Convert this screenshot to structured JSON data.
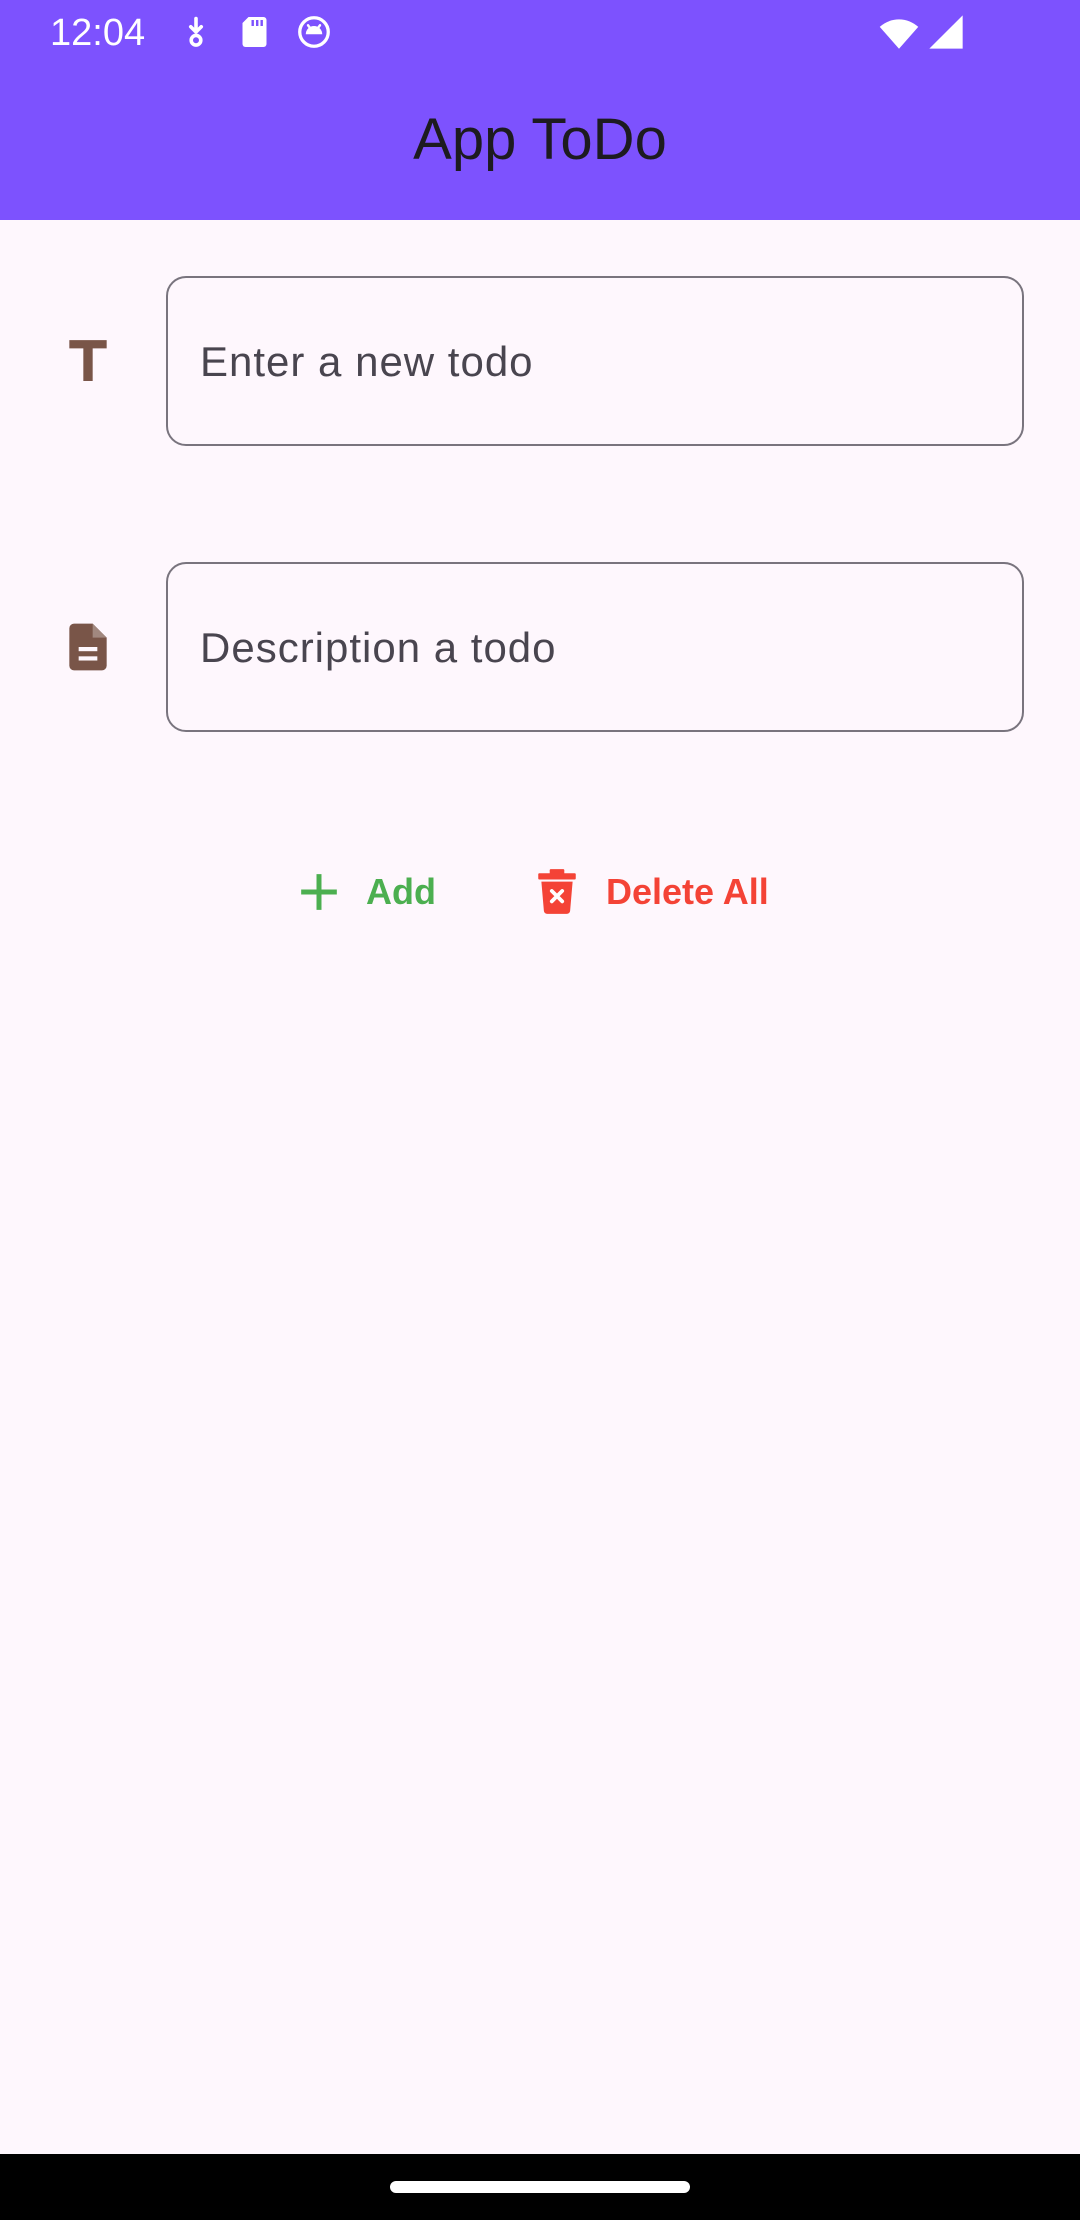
{
  "status_bar": {
    "time": "12:04",
    "left_icons": [
      "download-icon",
      "sd-card-icon",
      "android-debug-icon"
    ],
    "right_icons": [
      "wifi-icon",
      "cell-signal-icon"
    ]
  },
  "app_bar": {
    "title": "App ToDo",
    "background_color": "#7d52fe"
  },
  "form": {
    "title_field": {
      "icon": "title-icon",
      "value": "",
      "placeholder": "Enter a new todo"
    },
    "description_field": {
      "icon": "description-icon",
      "value": "",
      "placeholder": "Description a todo"
    }
  },
  "actions": {
    "add": {
      "label": "Add",
      "icon": "plus-icon",
      "color": "#4caf50"
    },
    "delete_all": {
      "label": "Delete All",
      "icon": "trash-icon",
      "color": "#f44336"
    }
  },
  "colors": {
    "icon_brown": "#795548",
    "page_background": "#fef7fd"
  }
}
